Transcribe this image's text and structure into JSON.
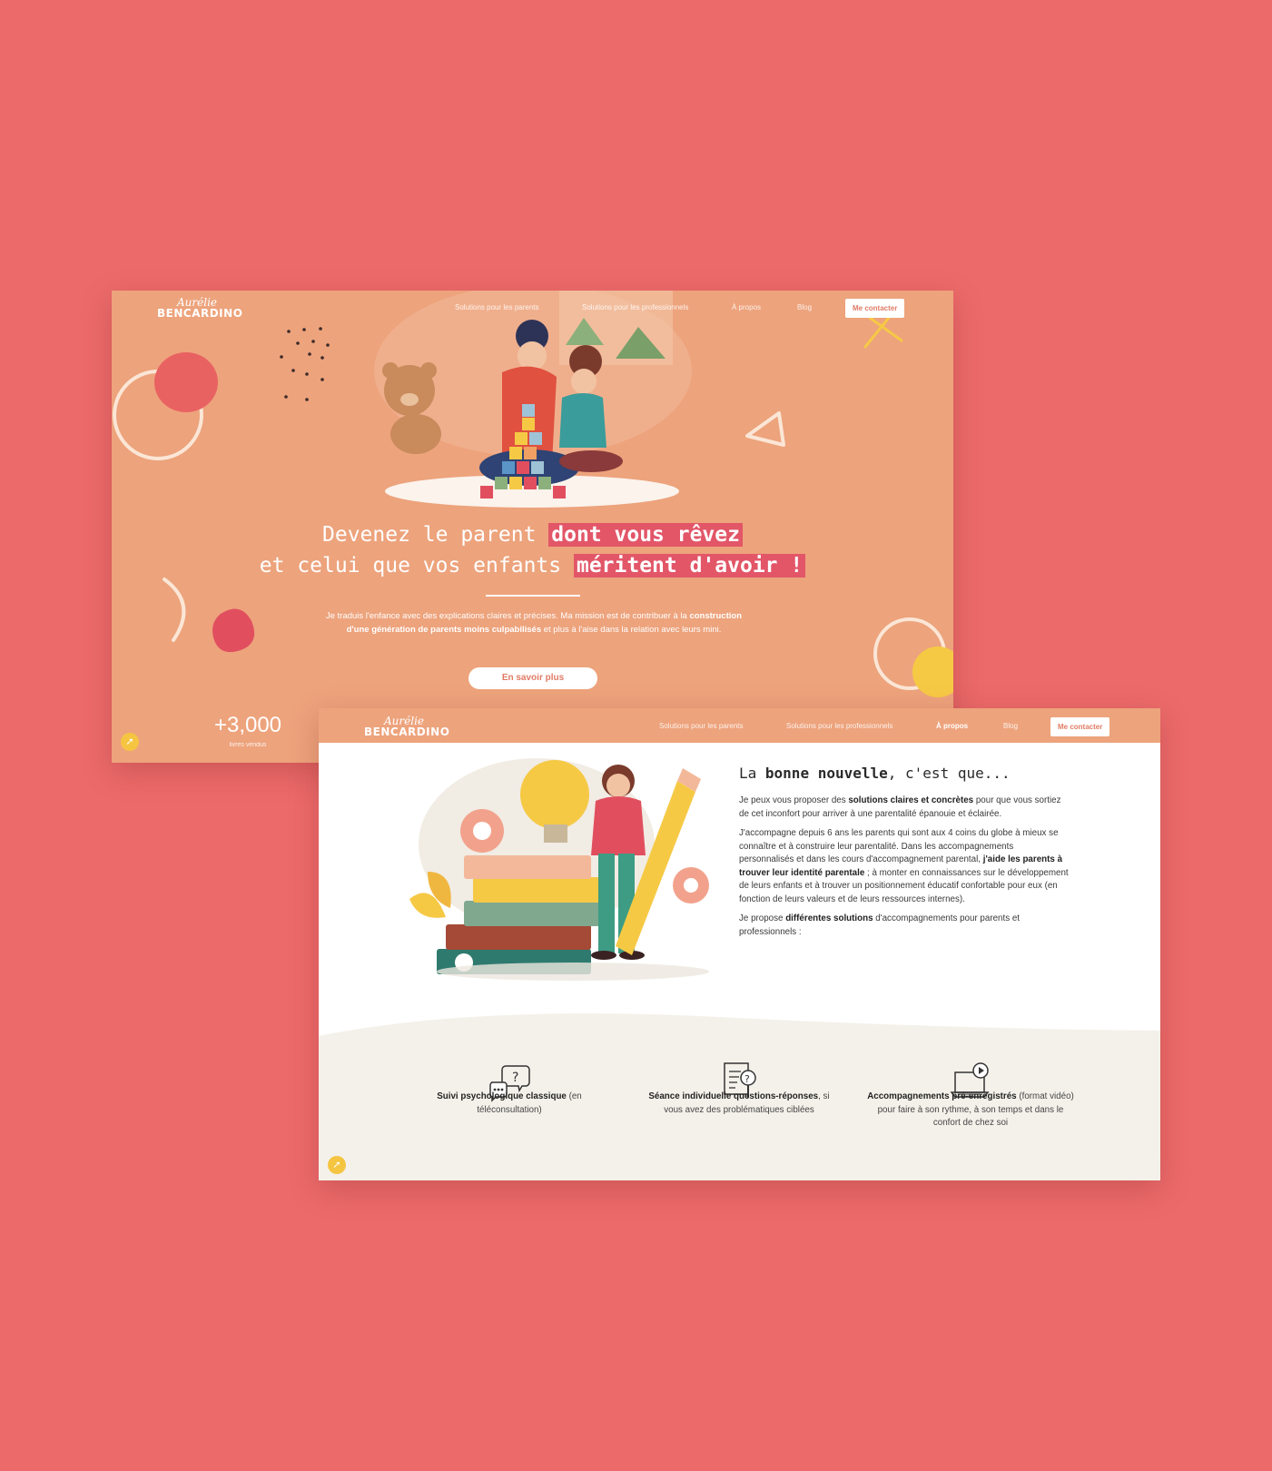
{
  "screen1": {
    "logo": {
      "script": "Aurélie",
      "main": "BENCARDINO"
    },
    "nav": [
      "Solutions pour les parents",
      "Solutions pour les professionnels",
      "À propos",
      "Blog"
    ],
    "contact_button": "Me contacter",
    "hero": {
      "line1_plain": "Devenez le parent ",
      "line1_highlight": "dont vous rêvez",
      "line2_plain": "et celui que vos enfants ",
      "line2_highlight": "méritent d'avoir !",
      "text_before": "Je traduis l'enfance avec des explications claires et précises. Ma mission est de contribuer à la ",
      "text_bold": "construction d'une génération de parents moins culpabilisés",
      "text_after": " et plus à l'aise dans la relation avec leurs mini.",
      "cta": "En savoir plus"
    },
    "stat": {
      "value": "+3,000",
      "label": "livres vendus"
    }
  },
  "screen2": {
    "logo": {
      "script": "Aurélie",
      "main": "BENCARDINO"
    },
    "nav": [
      "Solutions pour les parents",
      "Solutions pour les professionnels",
      "À propos",
      "Blog"
    ],
    "contact_button": "Me contacter",
    "title_plain1": "La ",
    "title_bold": "bonne nouvelle",
    "title_plain2": ", c'est que...",
    "p1_a": "Je peux vous proposer des ",
    "p1_b": "solutions claires et concrètes",
    "p1_c": " pour que vous sortiez de cet inconfort pour arriver à une parentalité épanouie et éclairée.",
    "p2_a": "J'accompagne depuis 6 ans les parents qui sont aux 4 coins du globe à mieux se connaître et à construire leur parentalité. Dans les accompagnements personnalisés et dans les cours d'accompagnement parental, ",
    "p2_b": "j'aide les parents à trouver leur identité parentale",
    "p2_c": " ; à monter en connaissances sur le développement de leurs enfants et à trouver un positionnement éducatif confortable pour eux (en fonction de leurs valeurs et de leurs ressources internes).",
    "p3_a": "Je propose ",
    "p3_b": "différentes solutions",
    "p3_c": " d'accompagnements pour parents et professionnels :",
    "services": [
      {
        "icon": "speech-bubble-question-icon",
        "bold": "Suivi psychologique classique",
        "rest": " (en téléconsultation)"
      },
      {
        "icon": "document-magnifier-icon",
        "bold": "Séance individuelle questions-réponses",
        "rest": ", si vous avez des problématiques ciblées"
      },
      {
        "icon": "laptop-icon",
        "bold": "Accompagnements pré-enregistrés",
        "rest": " (format vidéo) pour faire à son rythme, à son temps et dans le confort de chez soi"
      }
    ]
  },
  "colors": {
    "background": "#ec6a6a",
    "hero": "#eda37c",
    "highlight": "#e25668",
    "badge": "#f5c542"
  }
}
